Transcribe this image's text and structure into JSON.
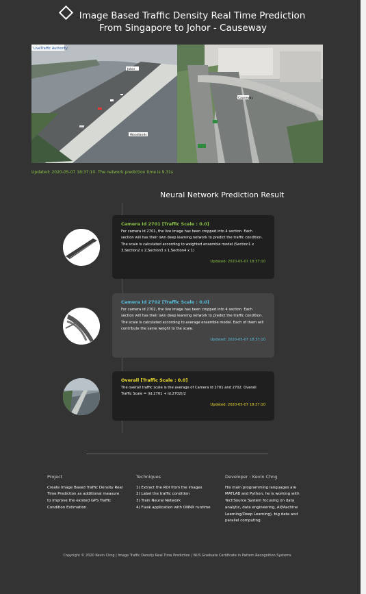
{
  "header": {
    "title_line1": "Image Based Traffic Density Real Time Prediction",
    "title_line2": "From Singapore to Johor - Causeway",
    "diamond_icon": "diamond-outline-icon"
  },
  "cameras": {
    "cam1_brand": "LiveTraffic Authority",
    "cam1_labels": [
      "Johor",
      "Woodlands"
    ],
    "cam2_labels": [
      "Causeway"
    ]
  },
  "status": {
    "updated_text": "Updated: 2020-05-07 18:37:10. The network prediction time is 9.31s"
  },
  "results": {
    "heading": "Neural Network Prediction Result",
    "cards": [
      {
        "title": "Camera Id 2701 [Traffic Scale : 0.0]",
        "body": "For camera id 2701, the live image has been cropped into 4 section. Each section will has their own deep learning network to predict the traffic condition. The scale is calculated according to weighted ensemble model (Section1 x 3,Section2 x 2,Section3 x 1,Section4 x 1)",
        "updated": "Updated: 2020-05-07 18:37:10",
        "accent": "#8bc34a"
      },
      {
        "title": "Camera Id 2702 [Traffic Scale : 0.0]",
        "body": "For camera id 2702, the live image has been cropped into 4 section. Each section will has their own deep learning network to predict the traffic condition. The scale is calculated according to average ensemble model. Each of them will contribute the same weight to the scale.",
        "updated": "Updated: 2020-05-07 18:37:10",
        "accent": "#5bc0de"
      },
      {
        "title": "Overall [Traffic Scale : 0.0]",
        "body": "The overall traffic scale is the average of Camera id 2701 and 2702. Overall Traffic Scale = (id.2701 + id.2702)/2",
        "updated": "Updated: 2020-05-07 18:37:10",
        "accent": "#f0e030"
      }
    ]
  },
  "footer": {
    "project_head": "Project",
    "project_text": "Create Image Based Traffic Density Real Time Prediction as additional measure to improve the existed GPS Traffic Condition Estimation.",
    "tech_head": "Techniques",
    "tech_items": [
      "1) Extract the ROI from the images",
      "2) Label the traffic condition",
      "3) Train Neural Network",
      "4) Flask application with ONNX runtime"
    ],
    "dev_head": "Developer : Kevin Chng",
    "dev_text": "His main programming languages are MATLAB and Python, he is working with TechSource System focusing on data analytic, data engineering, AI(Machine Learning/Deep Learning), big data and parallel computing.",
    "copyright": "Copyright © 2020 Kevin Chng | Image Traffic Density Real Time Prediction | NUS Graduate Certificate in Pattern Recognition Systems"
  }
}
